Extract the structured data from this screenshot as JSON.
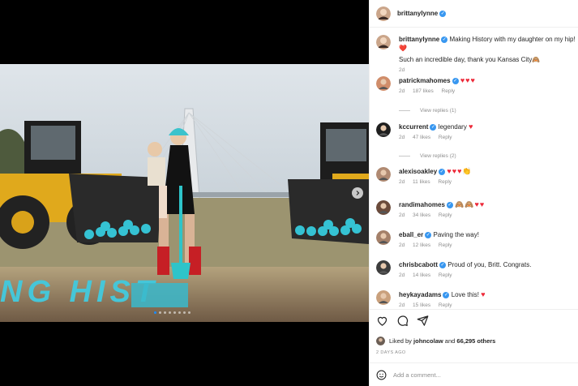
{
  "post": {
    "author": "brittanylynne",
    "caption": "Making History with my daughter on my hip! ❤️",
    "caption_line2": "Such an incredible day, thank you Kansas City🙈",
    "caption_time": "2d",
    "photo_ground_text": "NG HIST",
    "carousel_dots": 8,
    "carousel_active": 0
  },
  "comments": [
    {
      "user": "patrickmahomes",
      "text": "",
      "emoji": "♥♥♥",
      "time": "2d",
      "likes": "187 likes",
      "reply": "Reply",
      "view_replies": "View replies (1)"
    },
    {
      "user": "kccurrent",
      "text": "legendary",
      "emoji": "♥",
      "time": "2d",
      "likes": "47 likes",
      "reply": "Reply",
      "view_replies": "View replies (2)"
    },
    {
      "user": "alexisoakley",
      "text": "",
      "emoji": "♥♥♥👏",
      "time": "2d",
      "likes": "11 likes",
      "reply": "Reply"
    },
    {
      "user": "randimahomes",
      "text": "",
      "emoji": "🙈🙈♥♥",
      "time": "2d",
      "likes": "34 likes",
      "reply": "Reply"
    },
    {
      "user": "eball_er",
      "text": "Paving the way!",
      "emoji": "",
      "time": "2d",
      "likes": "12 likes",
      "reply": "Reply"
    },
    {
      "user": "chrisbcabott",
      "text": "Proud of you, Britt. Congrats.",
      "emoji": "",
      "time": "2d",
      "likes": "14 likes",
      "reply": "Reply"
    },
    {
      "user": "heykayadams",
      "text": "Love this!",
      "emoji": "♥",
      "time": "2d",
      "likes": "15 likes",
      "reply": "Reply"
    }
  ],
  "liked": {
    "prefix": "Liked by",
    "user": "johncolaw",
    "joiner": "and",
    "others": "66,295 others"
  },
  "date": "2 DAYS AGO",
  "add_comment_placeholder": "Add a comment...",
  "colors": {
    "verified": "#3897f0",
    "heart": "#ed2939",
    "muted": "#8e8e8e",
    "shovel": "#2ec4c9"
  }
}
